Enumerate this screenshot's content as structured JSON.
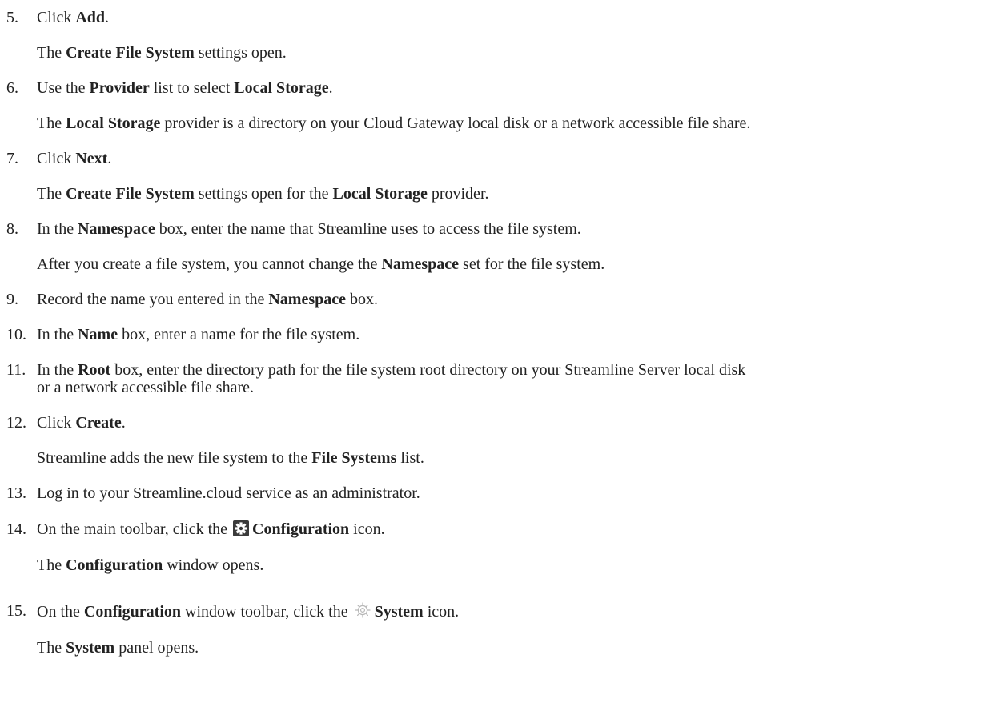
{
  "steps": {
    "s5": {
      "num": "5.",
      "a": "Click ",
      "b": "Add",
      "c": "."
    },
    "s5_desc": {
      "a": "The ",
      "b": "Create File System",
      "c": " settings open."
    },
    "s6": {
      "num": "6.",
      "a": "Use the ",
      "b": "Provider",
      "c": " list to select ",
      "d": "Local Storage",
      "e": "."
    },
    "s6_desc": {
      "a": "The ",
      "b": "Local Storage",
      "c": " provider is a directory on your Cloud Gateway local disk or a network accessible file share."
    },
    "s7": {
      "num": "7.",
      "a": "Click ",
      "b": "Next",
      "c": "."
    },
    "s7_desc": {
      "a": "The ",
      "b": "Create File System",
      "c": " settings open for the ",
      "d": "Local Storage",
      "e": " provider."
    },
    "s8": {
      "num": "8.",
      "a": "In the ",
      "b": "Namespace",
      "c": " box, enter the name that Streamline uses to access the file system."
    },
    "s8_desc": {
      "a": "After you create a file system, you cannot change the ",
      "b": "Namespace",
      "c": " set for the file system."
    },
    "s9": {
      "num": "9.",
      "a": "Record the name you entered in the ",
      "b": "Namespace",
      "c": " box."
    },
    "s10": {
      "num": "10.",
      "a": "In the ",
      "b": "Name",
      "c": " box, enter a name for the file system."
    },
    "s11": {
      "num": "11.",
      "a": "In the ",
      "b": "Root",
      "c": " box, enter the directory path for the file system root directory on your Streamline Server local disk",
      "d": "or a network accessible file share."
    },
    "s12": {
      "num": "12.",
      "a": "Click ",
      "b": "Create",
      "c": "."
    },
    "s12_desc": {
      "a": "Streamline adds the new file system to the ",
      "b": "File Systems",
      "c": " list."
    },
    "s13": {
      "num": "13.",
      "a": "Log in to your Streamline.cloud service as an administrator."
    },
    "s14": {
      "num": "14.",
      "a": "On the main toolbar, click the ",
      "b": "Configuration",
      "c": " icon.",
      "icon": "configuration-gear-icon"
    },
    "s14_desc": {
      "a": "The ",
      "b": "Configuration",
      "c": " window opens."
    },
    "s15": {
      "num": "15.",
      "a": "On the ",
      "b": "Configuration",
      "c": " window toolbar, click the ",
      "d": "System",
      "e": " icon.",
      "icon": "system-gear-icon"
    },
    "s15_desc": {
      "a": "The ",
      "b": "System",
      "c": " panel opens."
    }
  },
  "colors": {
    "text": "#222222",
    "config_icon_bg": "#3a3a3a",
    "system_icon_stroke": "#b8b8b8"
  }
}
